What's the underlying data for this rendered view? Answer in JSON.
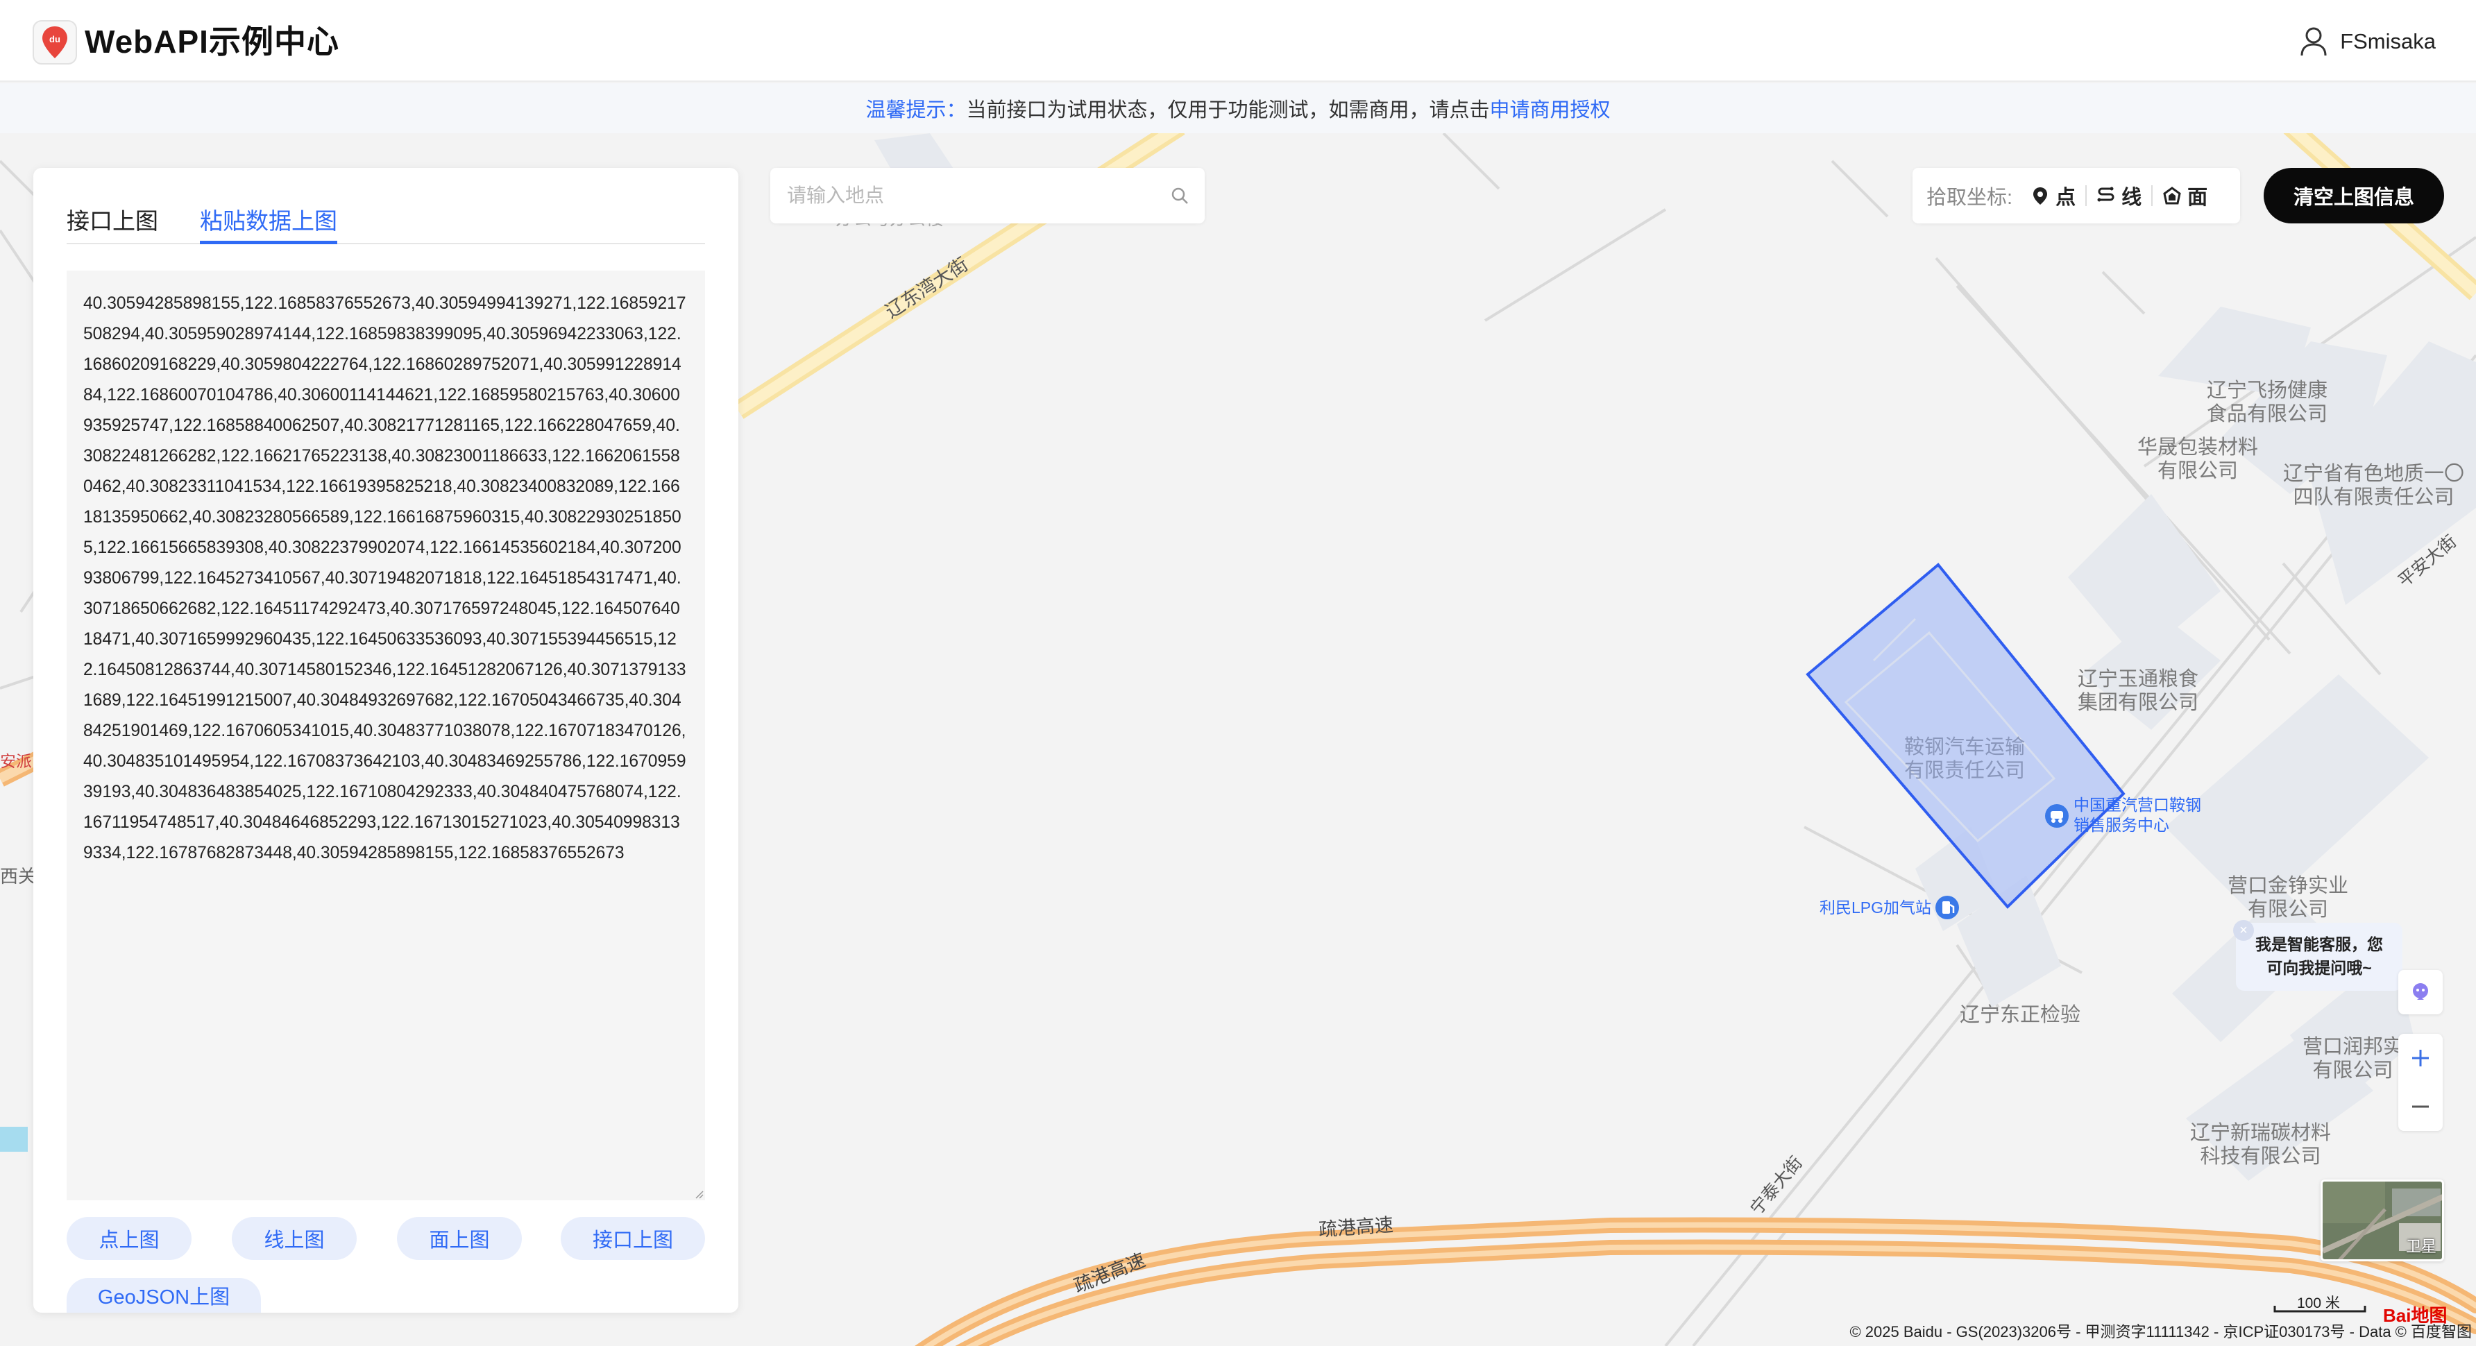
{
  "app": {
    "title": "WebAPI示例中心",
    "user_name": "FSmisaka"
  },
  "notice": {
    "label": "温馨提示：",
    "text": "当前接口为试用状态，仅用于功能测试，如需商用，请点击",
    "link": "申请商用授权"
  },
  "panel": {
    "tabs": [
      {
        "label": "接口上图",
        "active": false
      },
      {
        "label": "粘贴数据上图",
        "active": true
      }
    ],
    "textarea_value": "40.30594285898155,122.16858376552673,40.30594994139271,122.16859217508294,40.305959028974144,122.16859838399095,40.30596942233063,122.16860209168229,40.3059804222764,122.16860289752071,40.30599122891484,122.16860070104786,40.30600114144621,122.16859580215763,40.30600935925747,122.16858840062507,40.30821771281165,122.166228047659,40.30822481266282,122.16621765223138,40.30823001186633,122.16620615580462,40.30823311041534,122.16619395825218,40.30823400832089,122.16618135950662,40.30823280566589,122.16616875960315,40.308229302518505,122.16615665839308,40.30822379902074,122.16614535602184,40.30720093806799,122.1645273410567,40.30719482071818,122.16451854317471,40.30718650662682,122.16451174292473,40.307176597248045,122.16450764018471,40.3071659992960435,122.16450633536093,40.307155394456515,122.16450812863744,40.30714580152346,122.16451282067126,40.30713791331689,122.16451991215007,40.30484932697682,122.16705043466735,40.30484251901469,122.1670605341015,40.30483771038078,122.16707183470126,40.304835101495954,122.16708373642103,40.30483469255786,122.167095939193,40.304836483854025,122.16710804292333,40.304840475768074,122.16711954748517,40.30484646852293,122.16713015271023,40.305409983139334,122.16787682873448,40.30594285898155,122.16858376552673",
    "buttons": {
      "point": "点上图",
      "line": "线上图",
      "polygon": "面上图",
      "api": "接口上图",
      "geojson": "GeoJSON上图"
    }
  },
  "search": {
    "placeholder": "请输入地点"
  },
  "picker": {
    "label": "拾取坐标:",
    "point": "点",
    "line": "线",
    "polygon": "面"
  },
  "clear_button": "清空上图信息",
  "assistant": {
    "text": "我是智能客服，您可向我提问哦~"
  },
  "map": {
    "roads": {
      "liaodongwan": "辽东湾大街",
      "pingan": "平安大街",
      "shugang_1": "疏港高速",
      "shugang_2": "疏港高速",
      "ningtai": "宁泰大街"
    },
    "labels": {
      "feiyang": "辽宁飞扬健康\n食品有限公司",
      "huasheng": "华晟包装材料\n有限公司",
      "youse": "辽宁省有色地质一〇\n四队有限责任公司",
      "yutong": "辽宁玉通粮食\n集团有限公司",
      "angang": "鞍钢汽车运输\n有限责任公司",
      "jinzheng": "营口金铮实业\n有限公司",
      "dongzheng": "辽宁东正检验",
      "runbang": "营口润邦实\n有限公司",
      "xinruitan": "辽宁新瑞碳材料\n科技有限公司",
      "anpai": "安派",
      "xiguan": "西关",
      "top_cut": "办公与办公楼"
    },
    "pois": {
      "zhongguo": "中国重汽营口鞍钢\n销售服务中心",
      "lpg": "利民LPG加气站"
    },
    "satellite_label": "卫星",
    "scale": "100 米",
    "logo": "Bai地图",
    "copyright": "© 2025 Baidu - GS(2023)3206号 - 甲测资字11111342 - 京ICP证030173号 - Data © 百度智图"
  },
  "colors": {
    "accent": "#2f6af5",
    "polygon_fill": "#b7c8f5",
    "polygon_stroke": "#2f5df0",
    "highway": "#f5b774"
  }
}
